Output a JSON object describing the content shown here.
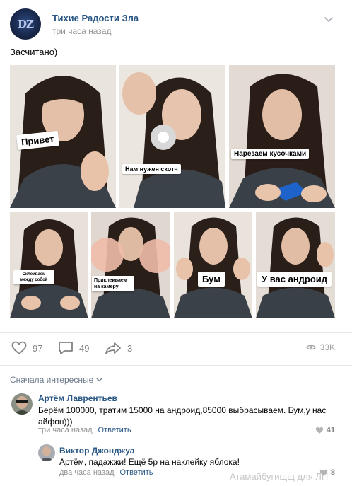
{
  "post": {
    "author": "Тихие Радости Зла",
    "time": "три часа назад",
    "text": "Засчитано)",
    "avatar_text": "DZ"
  },
  "photos": [
    {
      "caption": "Привет"
    },
    {
      "caption": "Нам нужен скотч"
    },
    {
      "caption": "Нарезаем кусочками"
    },
    {
      "caption": "Склеиваем между собой"
    },
    {
      "caption": "Приклеиваем на камеру"
    },
    {
      "caption": "Бум"
    },
    {
      "caption": "У вас андроид"
    }
  ],
  "actions": {
    "likes": "97",
    "comments": "49",
    "shares": "3",
    "views": "33K"
  },
  "comments_sort": "Сначала интересные",
  "comments": [
    {
      "author": "Артём Лаврентьев",
      "text_line1": "Берём 100000, тратим 15000 на андроид,85000 выбрасываем. Бум,у нас",
      "text_line2": "айфон)))",
      "time": "три часа назад",
      "reply": "Ответить",
      "likes": "41"
    },
    {
      "author": "Виктор Джонджуа",
      "text": "Артём, падажжи! Ещё 5р на наклейку яблока!",
      "time": "два часа назад",
      "reply": "Ответить",
      "likes": "8"
    }
  ],
  "watermark": "Атамайбугищщ для ЛП",
  "colors": {
    "link": "#2a5885",
    "meta": "#939393",
    "icon": "#828282"
  }
}
